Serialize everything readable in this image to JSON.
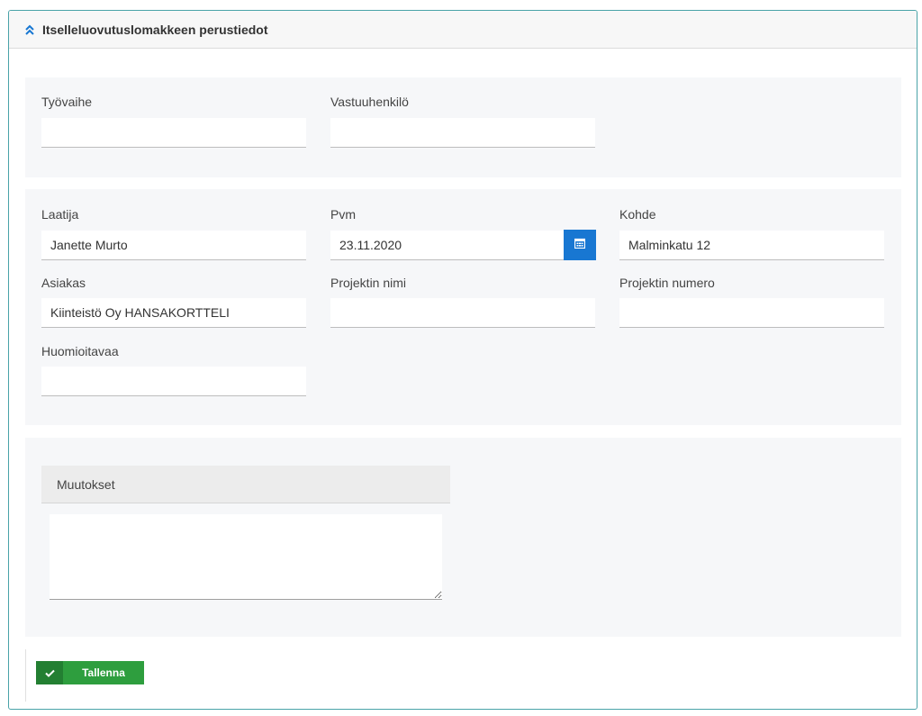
{
  "panel": {
    "title": "Itselleluovutuslomakkeen perustiedot",
    "collapse_icon": "double-chevron-up-icon"
  },
  "section1": {
    "tyovaihe": {
      "label": "Työvaihe",
      "value": ""
    },
    "vastuuhenkilo": {
      "label": "Vastuuhenkilö",
      "value": ""
    }
  },
  "section2": {
    "laatija": {
      "label": "Laatija",
      "value": "Janette Murto"
    },
    "pvm": {
      "label": "Pvm",
      "value": "23.11.2020",
      "icon": "calendar-icon"
    },
    "kohde": {
      "label": "Kohde",
      "value": "Malminkatu 12"
    },
    "asiakas": {
      "label": "Asiakas",
      "value": "Kiinteistö Oy HANSAKORTTELI"
    },
    "projektin_nimi": {
      "label": "Projektin nimi",
      "value": ""
    },
    "projektin_numero": {
      "label": "Projektin numero",
      "value": ""
    },
    "huomioitavaa": {
      "label": "Huomioitavaa",
      "value": ""
    }
  },
  "section3": {
    "muutokset": {
      "label": "Muutokset",
      "value": ""
    }
  },
  "footer": {
    "save_label": "Tallenna",
    "save_icon": "check-icon"
  },
  "colors": {
    "panel_border": "#4aa3a8",
    "accent_blue": "#1877d2",
    "save_green": "#2e9e3e"
  }
}
